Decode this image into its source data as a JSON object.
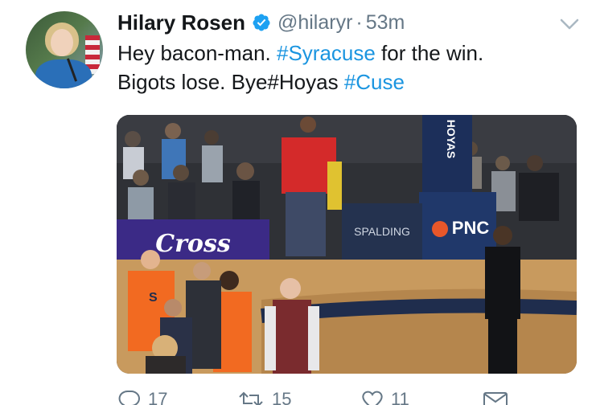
{
  "author": {
    "name": "Hilary Rosen",
    "handle": "@hilaryr",
    "separator": "·",
    "time": "53m"
  },
  "tweet": {
    "line1_a": "Hey bacon-man.  ",
    "line1_tag": "#Syracuse",
    "line1_b": " for the win.",
    "line2_a": "Bigots lose. Bye#Hoyas ",
    "line2_tag": "#Cuse"
  },
  "media": {
    "banner_text": "Cross",
    "sponsor_text": "PNC",
    "stanchion_text": "HOYAS",
    "baseline_brand": "SPALDING"
  },
  "actions": {
    "reply_count": "17",
    "retweet_count": "15",
    "like_count": "11"
  },
  "colors": {
    "link": "#1b95e0",
    "muted": "#657786",
    "verified": "#1da1f2",
    "orange_jersey": "#f26a21",
    "navy": "#1f2d4d"
  }
}
